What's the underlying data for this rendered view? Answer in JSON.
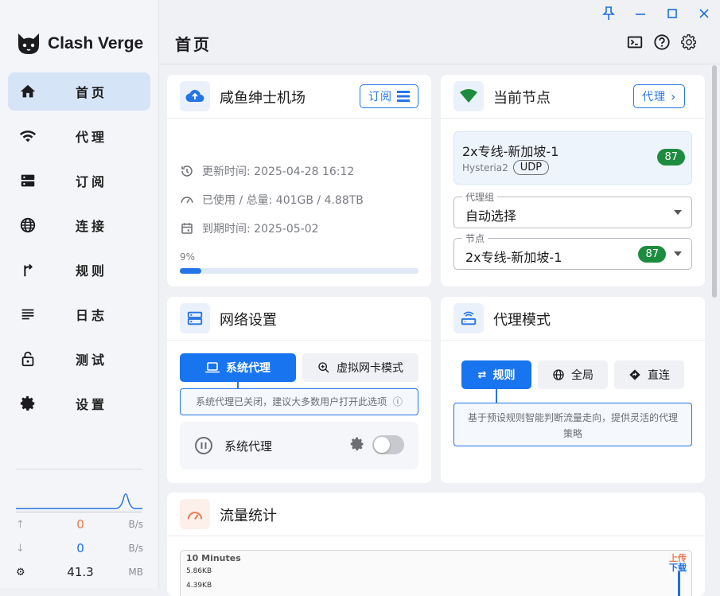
{
  "app": {
    "name": "Clash Verge"
  },
  "nav": [
    {
      "label": "首页",
      "icon": "home-icon",
      "active": true
    },
    {
      "label": "代理",
      "icon": "wifi-icon",
      "active": false
    },
    {
      "label": "订阅",
      "icon": "dns-icon",
      "active": false
    },
    {
      "label": "连接",
      "icon": "globe-icon",
      "active": false
    },
    {
      "label": "规则",
      "icon": "fork-icon",
      "active": false
    },
    {
      "label": "日志",
      "icon": "list-icon",
      "active": false
    },
    {
      "label": "测试",
      "icon": "lock-icon",
      "active": false
    },
    {
      "label": "设置",
      "icon": "gear-icon",
      "active": false
    }
  ],
  "traffic": {
    "upload": {
      "value": "0",
      "unit": "B/s",
      "color": "#e97a52"
    },
    "download": {
      "value": "0",
      "unit": "B/s",
      "color": "#1f6fde"
    },
    "memory": {
      "value": "41.3",
      "unit": "MB"
    }
  },
  "header": {
    "title": "首页"
  },
  "profile": {
    "title": "咸鱼绅士机场",
    "button": "订阅",
    "updated": "更新时间: 2025-04-28 16:12",
    "usage": "已使用 / 总量: 401GB / 4.88TB",
    "expire": "到期时间: 2025-05-02",
    "percent_label": "9%",
    "percent": 0.09
  },
  "current_node": {
    "title": "当前节点",
    "button": "代理",
    "node_name": "2x专线-新加坡-1",
    "protocol": "Hysteria2",
    "chip": "UDP",
    "delay": "87",
    "group_legend": "代理组",
    "group_value": "自动选择",
    "node_legend": "节点",
    "node_value": "2x专线-新加坡-1",
    "node_delay": "87"
  },
  "network": {
    "title": "网络设置",
    "tab_system": "系统代理",
    "tab_tun": "虚拟网卡模式",
    "hint": "系统代理已关闭，建议大多数用户打开此选项",
    "row_label": "系统代理"
  },
  "proxy_mode": {
    "title": "代理模式",
    "rule": "规则",
    "global": "全局",
    "direct": "直连",
    "hint": "基于预设规则智能判断流量走向，提供灵活的代理策略"
  },
  "traffic_stats": {
    "title": "流量统计",
    "range": "10 Minutes",
    "tick1": "5.86KB",
    "tick2": "4.39KB",
    "legend_up": "上传",
    "legend_down": "下载"
  },
  "colors": {
    "accent": "#2575e6",
    "green": "#1e8c3e",
    "orange": "#e97a52"
  }
}
